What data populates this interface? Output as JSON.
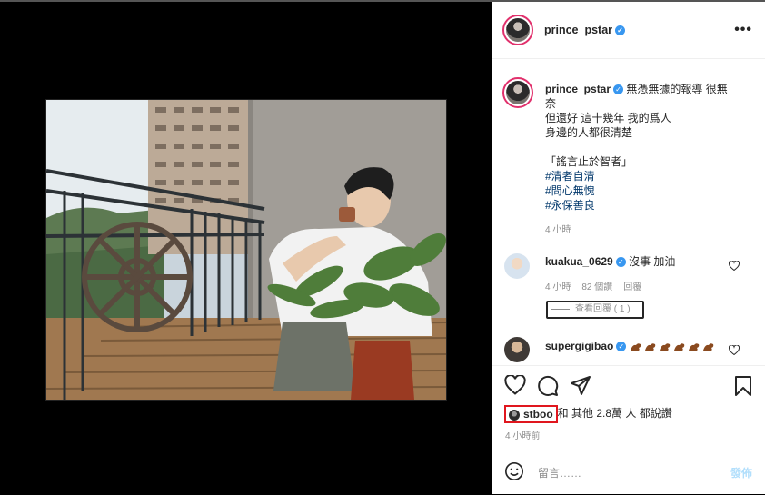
{
  "post": {
    "author": "prince_pstar",
    "more_icon": "more-horizontal-icon"
  },
  "caption": {
    "username": "prince_pstar",
    "lines": [
      "無憑無據的報導 很無",
      "奈",
      "但還好 這十幾年 我的爲人",
      "身邊的人都很清楚",
      "",
      "「謠言止於智者」"
    ],
    "hashtags": [
      "#清者自清",
      "#問心無愧",
      "#永保善良"
    ],
    "time": "4 小時"
  },
  "comments": [
    {
      "username": "kuakua_0629",
      "text": "沒事 加油",
      "time": "4 小時",
      "likes": "82 個讚",
      "reply": "回覆",
      "view_replies": "查看回覆 ( 1 )"
    },
    {
      "username": "supergigibao",
      "emoji_count": 6
    }
  ],
  "likes": {
    "liked_by": "stboo",
    "rest": "和 其他 2.8萬 人 都說讚"
  },
  "post_time": "4 小時前",
  "comment_bar": {
    "placeholder": "留言……",
    "post_label": "發佈",
    "post_color": "#b2dffc"
  },
  "colors": {
    "verified": "#3897f0",
    "highlight": "#e0161e",
    "hashtag": "#00376b"
  }
}
